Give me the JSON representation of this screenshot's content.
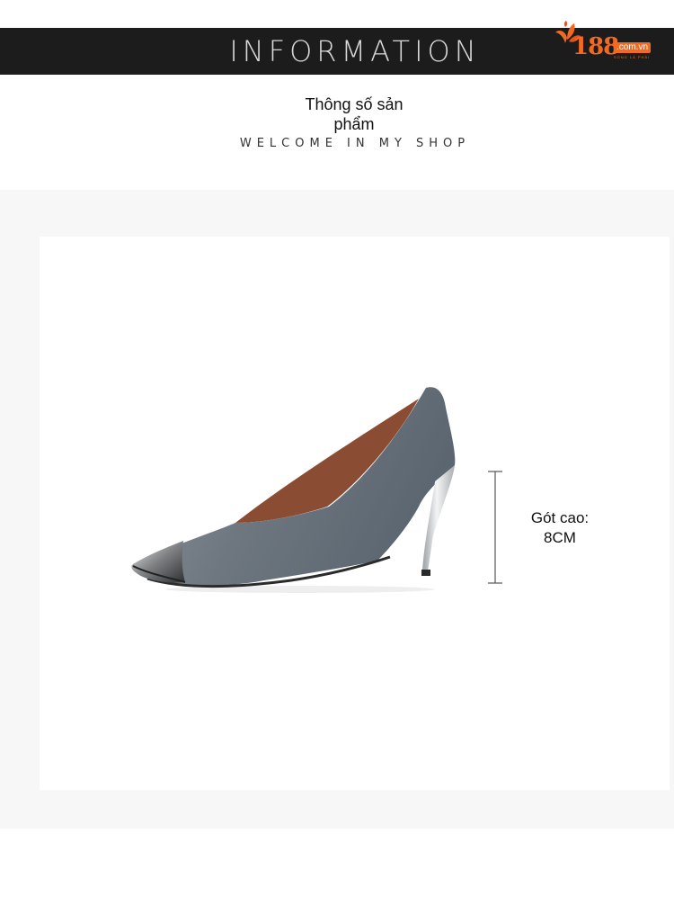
{
  "banner": {
    "title": "INFORMATION",
    "background_color": "#1c1c1c",
    "title_color": "#d8d8d8"
  },
  "logo": {
    "number": "188",
    "domain": ".com.vn",
    "tagline": "SỐNG LÀ PHẢI",
    "brand_color": "#f26a21",
    "icon": "orange-leaf-icon"
  },
  "header": {
    "title": "Thông số sản phẩm",
    "subtitle": "WELCOME IN MY SHOP"
  },
  "product_image": {
    "image": "grey-stiletto-pump-with-metal-toe-cap",
    "heel_label_line1": "Gót cao:",
    "heel_label_line2": "8CM"
  }
}
